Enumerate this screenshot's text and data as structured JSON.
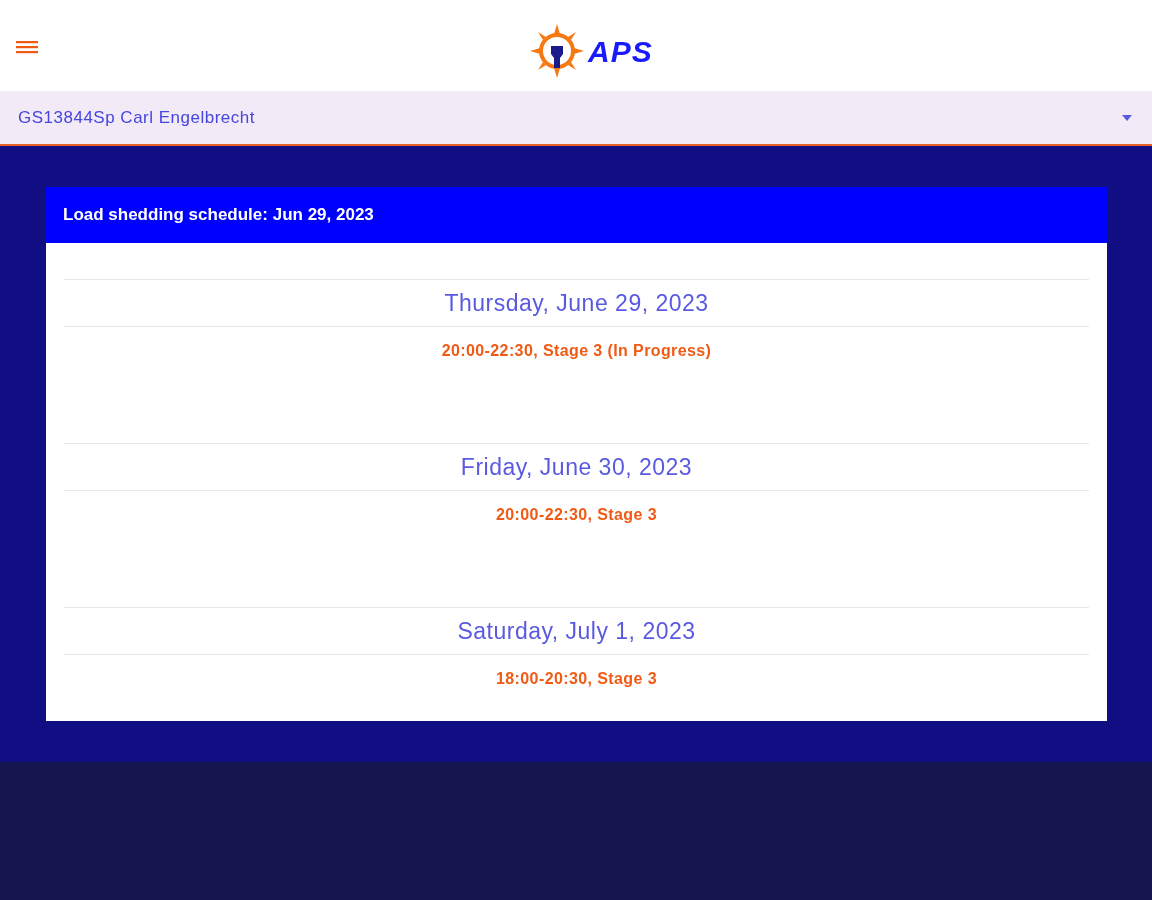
{
  "header": {
    "logo_text": "APS"
  },
  "account_select": {
    "value": "GS13844Sp Carl Engelbrecht"
  },
  "schedule": {
    "title": "Load shedding schedule: Jun 29, 2023",
    "days": [
      {
        "date": "Thursday, June 29, 2023",
        "slots": [
          "20:00-22:30, Stage 3 (In Progress)"
        ]
      },
      {
        "date": "Friday, June 30, 2023",
        "slots": [
          "20:00-22:30, Stage 3"
        ]
      },
      {
        "date": "Saturday, July 1, 2023",
        "slots": [
          "18:00-20:30, Stage 3"
        ]
      }
    ]
  }
}
